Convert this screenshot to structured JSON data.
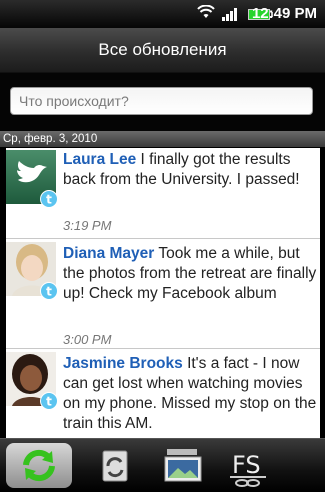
{
  "status": {
    "time": "12:49 PM"
  },
  "title": "Все обновления",
  "compose": {
    "placeholder": "Что происходит?"
  },
  "date_header": "Ср, февр. 3, 2010",
  "feed": [
    {
      "name": "Laura Lee",
      "message": "I finally got the results back from the University. I passed!",
      "time": "3:19 PM"
    },
    {
      "name": "Diana Mayer",
      "message": "Took me a while, but the photos from the retreat are finally up! Check my Facebook album",
      "time": "3:00 PM"
    },
    {
      "name": "Jasmine Brooks",
      "message": "It's a fact - I now can get lost when watching movies on my phone. Missed my stop on the train this AM.",
      "time": ""
    }
  ],
  "tabs": [
    {
      "icon": "refresh-icon"
    },
    {
      "icon": "sync-card-icon"
    },
    {
      "icon": "photo-icon"
    },
    {
      "icon": "friendstream-icon"
    }
  ],
  "colors": {
    "accent_name": "#1f5fb6",
    "active_tab_icon": "#36c21e"
  }
}
